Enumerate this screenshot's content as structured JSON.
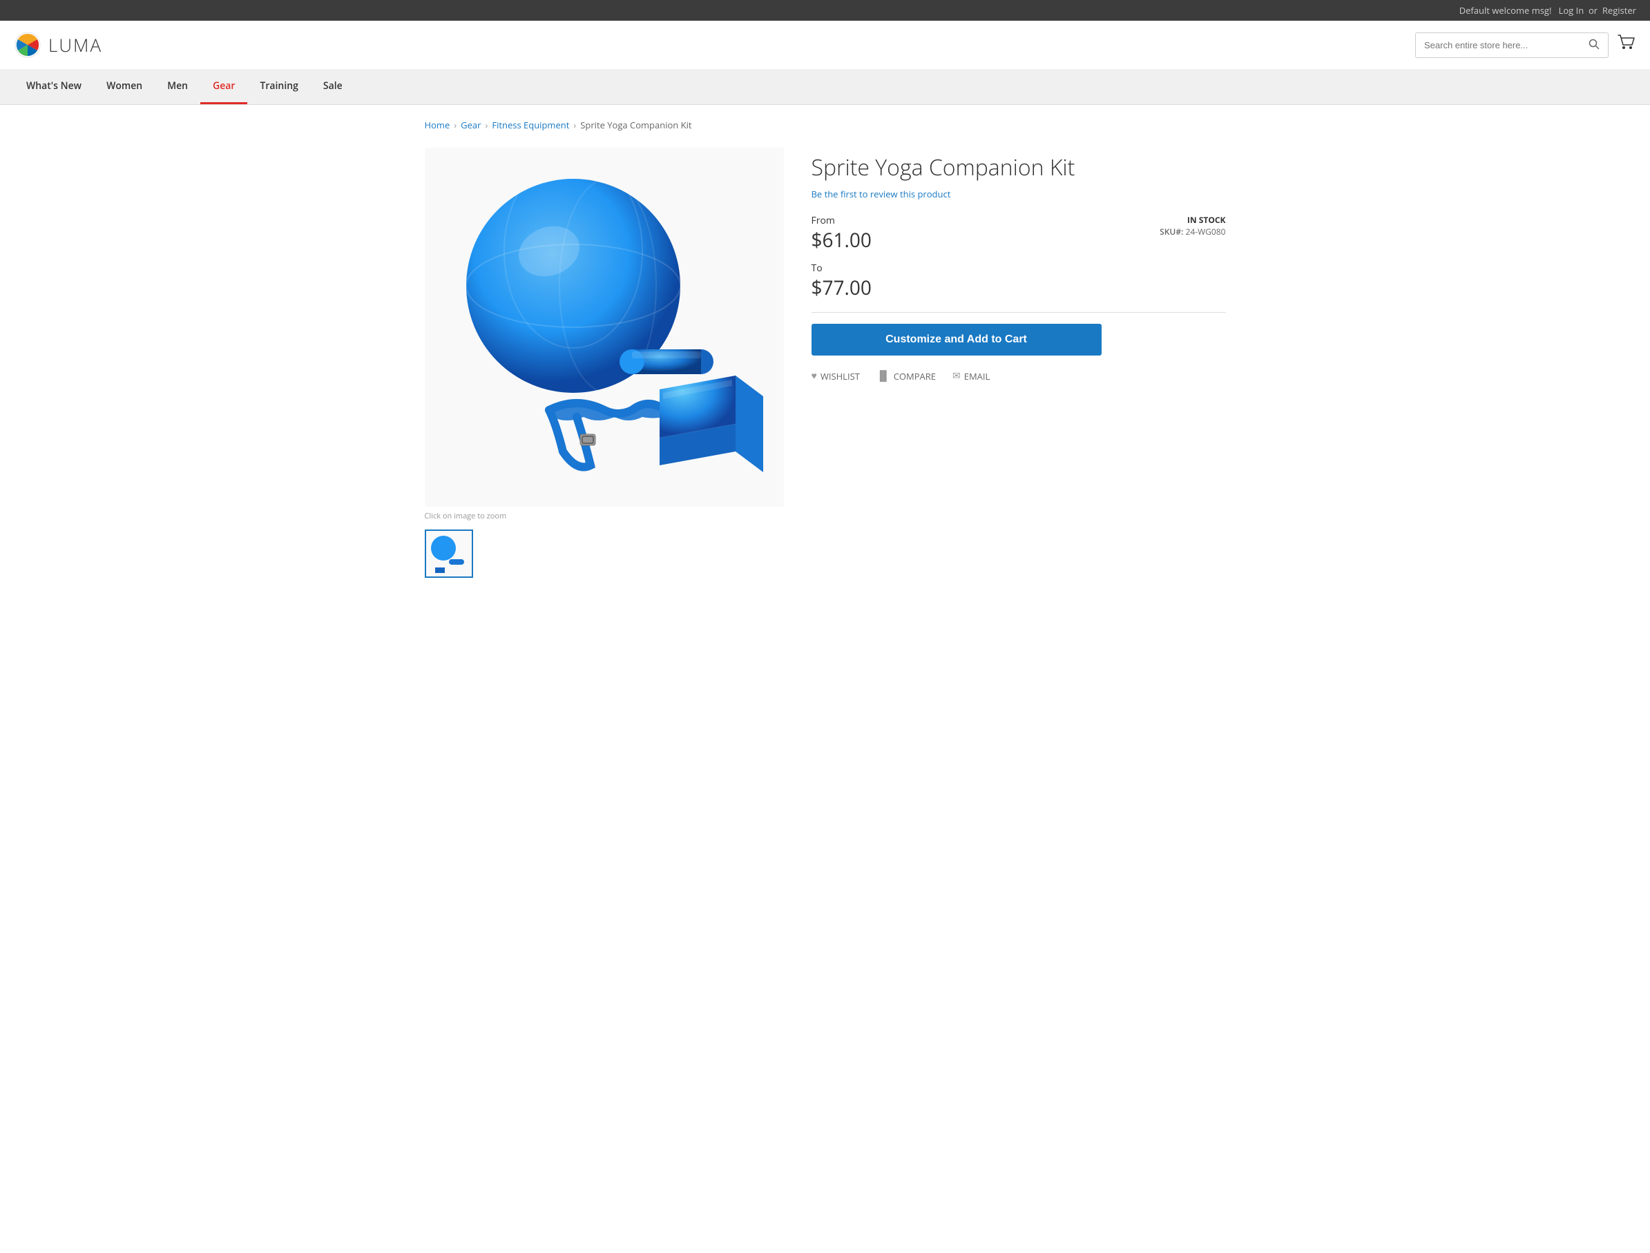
{
  "topbar": {
    "welcome": "Default welcome msg!",
    "login": "Log In",
    "or": "or",
    "register": "Register"
  },
  "header": {
    "logo_text": "LUMA",
    "search_placeholder": "Search entire store here...",
    "cart_label": "Cart"
  },
  "nav": {
    "items": [
      {
        "label": "What's New",
        "active": false
      },
      {
        "label": "Women",
        "active": false
      },
      {
        "label": "Men",
        "active": false
      },
      {
        "label": "Gear",
        "active": true
      },
      {
        "label": "Training",
        "active": false
      },
      {
        "label": "Sale",
        "active": false
      }
    ]
  },
  "breadcrumb": {
    "items": [
      "Home",
      "Gear",
      "Fitness Equipment"
    ],
    "current": "Sprite Yoga Companion Kit"
  },
  "product": {
    "title": "Sprite Yoga Companion Kit",
    "review_link": "Be the first to review this product",
    "price_from_label": "From",
    "price_from": "$61.00",
    "price_to_label": "To",
    "price_to": "$77.00",
    "stock_status": "IN STOCK",
    "sku_label": "SKU#:",
    "sku": "24-WG080",
    "add_to_cart": "Customize and Add to Cart",
    "wishlist": "WISHLIST",
    "compare": "COMPARE",
    "email": "EMAIL",
    "zoom_hint": "Click on image to zoom"
  }
}
